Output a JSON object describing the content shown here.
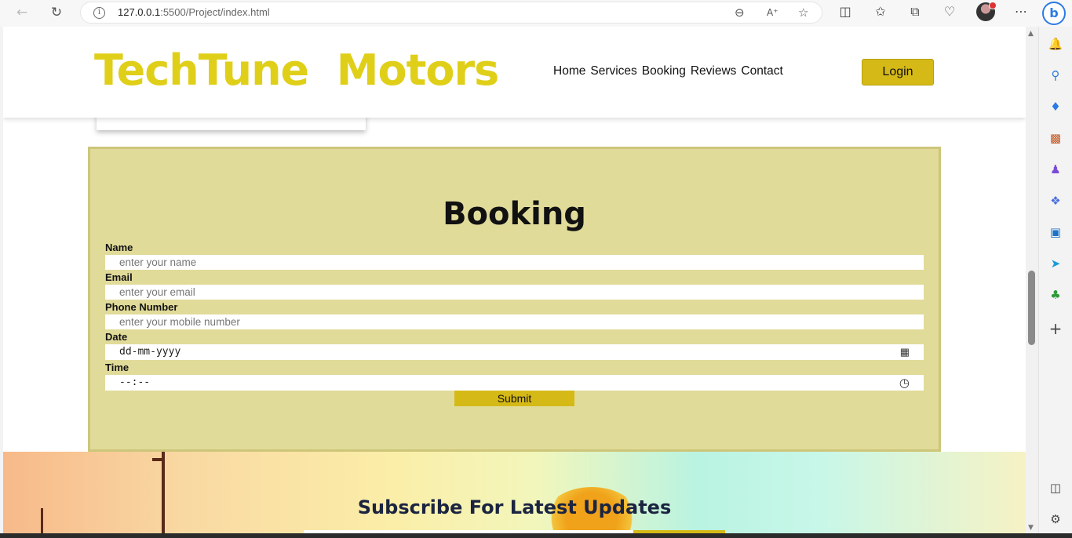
{
  "browser": {
    "url_host": "127.0.0.1",
    "url_rest": ":5500/Project/index.html",
    "icons": [
      "back-icon",
      "reload-icon",
      "info-icon",
      "zoom-out-icon",
      "read-aloud-icon",
      "favorite-star-icon",
      "split-screen-icon",
      "favorites-icon",
      "collections-icon",
      "performance-icon",
      "profile-avatar",
      "more-icon",
      "copilot-icon"
    ]
  },
  "sidebar": {
    "icons": [
      "bell-icon",
      "search-icon",
      "shopping-tag-icon",
      "toolbox-icon",
      "games-icon",
      "microsoft365-icon",
      "outlook-icon",
      "send-icon",
      "tree-icon",
      "add-icon",
      "sidebar-toggle-icon",
      "settings-icon"
    ]
  },
  "header": {
    "logo": "TechTune  Motors",
    "nav": [
      "Home",
      "Services",
      "Booking",
      "Reviews",
      "Contact"
    ],
    "login": "Login"
  },
  "booking": {
    "title": "Booking",
    "fields": [
      {
        "label": "Name",
        "placeholder": "enter your name"
      },
      {
        "label": "Email",
        "placeholder": "enter your email"
      },
      {
        "label": "Phone Number",
        "placeholder": "enter your mobile number"
      },
      {
        "label": "Date",
        "value": "dd-mm-yyyy"
      },
      {
        "label": "Time",
        "value": "--:--"
      }
    ],
    "submit": "Submit"
  },
  "subscribe": {
    "title": "Subscribe For Latest Updates"
  },
  "colors": {
    "accent": "#d5b917",
    "logo": "#e0cf19",
    "booking_bg": "#e1db9a"
  }
}
